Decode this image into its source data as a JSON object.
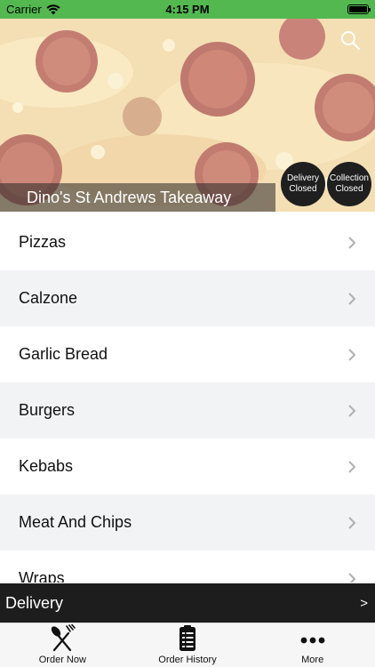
{
  "status_bar": {
    "carrier": "Carrier",
    "time": "4:15 PM"
  },
  "hero": {
    "title": "Dino's St Andrews Takeaway",
    "delivery_status": {
      "line1": "Delivery",
      "line2": "Closed"
    },
    "collection_status": {
      "line1": "Collection",
      "line2": "Closed"
    }
  },
  "menu": {
    "items": [
      {
        "label": "Pizzas"
      },
      {
        "label": "Calzone"
      },
      {
        "label": "Garlic Bread"
      },
      {
        "label": "Burgers"
      },
      {
        "label": "Kebabs"
      },
      {
        "label": "Meat And Chips"
      },
      {
        "label": "Wraps"
      }
    ]
  },
  "delivery_bar": {
    "label": "Delivery",
    "arrow": ">"
  },
  "tabs": [
    {
      "label": "Order Now",
      "icon": "fork-knife-icon"
    },
    {
      "label": "Order History",
      "icon": "clipboard-icon"
    },
    {
      "label": "More",
      "icon": "more-dots-icon"
    }
  ],
  "colors": {
    "status_bar": "#53b84f",
    "dark": "#1d1d1d"
  }
}
